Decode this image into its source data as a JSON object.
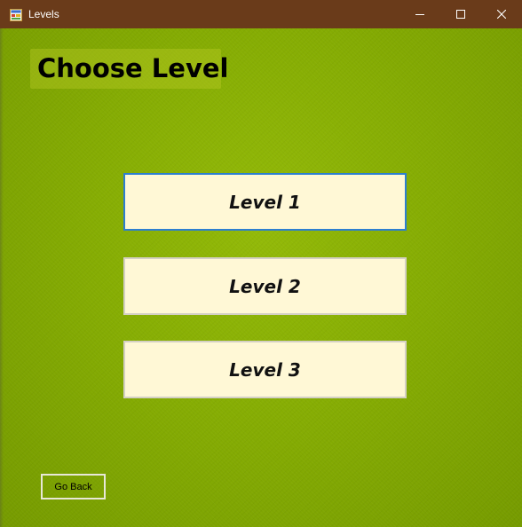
{
  "window": {
    "title": "Levels",
    "app_icon": "app-icon",
    "controls": {
      "minimize": "minimize-icon",
      "maximize": "maximize-icon",
      "close": "close-icon"
    },
    "titlebar_color": "#6a3b1a"
  },
  "main": {
    "heading": "Choose Level",
    "background_color": "#86ad03",
    "levels": [
      {
        "label": "Level 1",
        "focused": true
      },
      {
        "label": "Level 2",
        "focused": false
      },
      {
        "label": "Level 3",
        "focused": false
      }
    ],
    "button_color": "#fff8d6",
    "focus_color": "#2d7fd0",
    "go_back_label": "Go Back"
  }
}
